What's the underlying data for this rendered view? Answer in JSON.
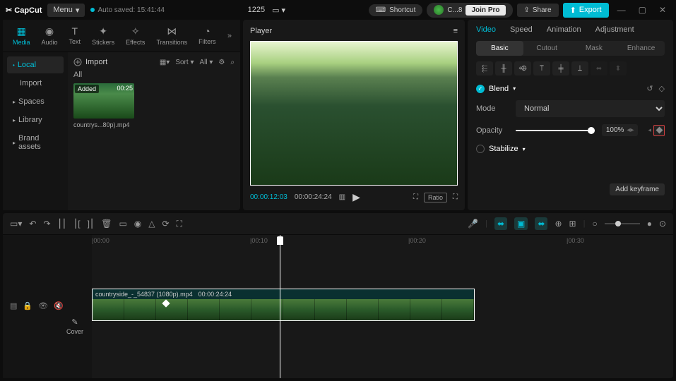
{
  "titlebar": {
    "logo": "✂ CapCut",
    "menu": "Menu",
    "auto_saved": "Auto saved: 15:41:44",
    "project_name": "1225",
    "shortcut": "Shortcut",
    "user": "C...8",
    "join_pro": "Join Pro",
    "share": "Share",
    "export": "Export"
  },
  "left_tabs": [
    "Media",
    "Audio",
    "Text",
    "Stickers",
    "Effects",
    "Transitions",
    "Filters"
  ],
  "sidebar": {
    "local": "Local",
    "import": "Import",
    "spaces": "Spaces",
    "library": "Library",
    "brand": "Brand assets"
  },
  "media": {
    "import": "Import",
    "sort": "Sort",
    "all_filter": "All",
    "all": "All",
    "clip_added": "Added",
    "clip_duration": "00:25",
    "clip_name": "countrys...80p).mp4"
  },
  "player": {
    "title": "Player",
    "time_current": "00:00:12:03",
    "time_total": "00:00:24:24",
    "ratio": "Ratio"
  },
  "right": {
    "tabs": [
      "Video",
      "Speed",
      "Animation",
      "Adjustment"
    ],
    "sub_tabs": [
      "Basic",
      "Cutout",
      "Mask",
      "Enhance"
    ],
    "blend": "Blend",
    "mode_label": "Mode",
    "mode_value": "Normal",
    "opacity_label": "Opacity",
    "opacity_value": "100%",
    "stabilize": "Stabilize",
    "tooltip": "Add keyframe"
  },
  "timeline": {
    "ruler": [
      "|00:00",
      "|00:10",
      "|00:20",
      "|00:30"
    ],
    "clip_name": "countryside_-_54837 (1080p).mp4",
    "clip_dur": "00:00:24:24",
    "cover": "Cover"
  }
}
